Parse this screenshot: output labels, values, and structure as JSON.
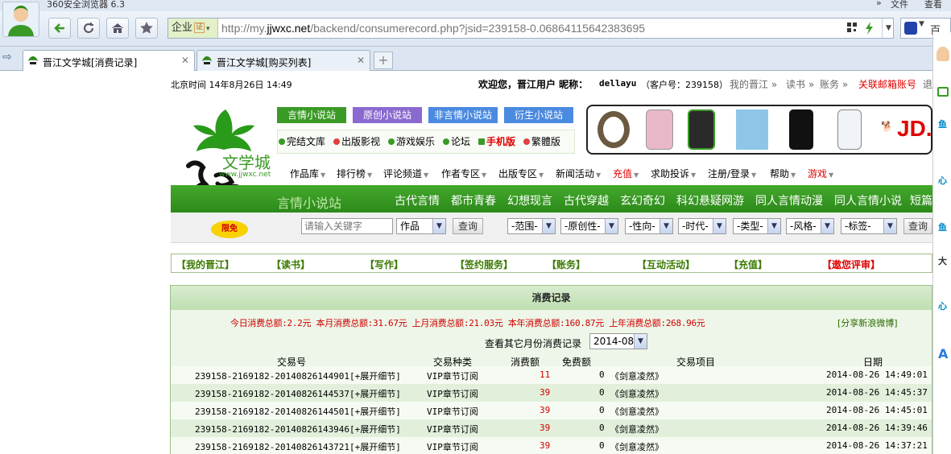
{
  "browser": {
    "title": "360安全浏览器 6.3",
    "menu": [
      "文件",
      "查看"
    ],
    "address_prefix": "企业",
    "address_badge": "证",
    "url_domain_pre": "http://my.",
    "url_domain": "jjwxc.net",
    "url_path": "/backend/consumerecord.php?jsid=239158-0.06864115642383695",
    "tabs": [
      {
        "label": "晋江文学城[消费记录]",
        "active": true
      },
      {
        "label": "晋江文学城[购买列表]",
        "active": false
      }
    ],
    "new_tab": "+",
    "sidebar_snippets": [
      "鱼",
      "心",
      "鱼",
      "大",
      "心",
      "A"
    ]
  },
  "header": {
    "time_label": "北京时间 14年8月26日 14:49",
    "welcome": "欢迎您，晋江用户 昵称：",
    "nickname": "dellayu",
    "customer_no": "（客户号：239158）",
    "links": [
      "我的晋江 »",
      "读书 »",
      "账务 »"
    ],
    "mail_link": "关联邮箱账号",
    "extra": "退"
  },
  "logo": {
    "site_name": "文学城",
    "site_url": "www.jjwxc.net",
    "brand": "晋江"
  },
  "site_buttons": [
    {
      "label": "言情小说站",
      "color": "#3a9a26"
    },
    {
      "label": "原创小说站",
      "color": "#8a6ad0"
    },
    {
      "label": "非言情小说站",
      "color": "#4a8ae0"
    },
    {
      "label": "衍生小说站",
      "color": "#4a8ae0"
    }
  ],
  "sub_links": [
    {
      "label": "完结文库",
      "color": "#3a9a26",
      "text_color": "#000"
    },
    {
      "label": "出版影视",
      "color": "#e04040",
      "text_color": "#000"
    },
    {
      "label": "游戏娱乐",
      "color": "#3a9a26",
      "text_color": "#000"
    },
    {
      "label": "论坛",
      "color": "#3a9a26",
      "text_color": "#000"
    },
    {
      "label": "手机版",
      "color": "#3a9a26",
      "text_color": "#e00000"
    },
    {
      "label": "繁體版",
      "color": "#e04040",
      "text_color": "#000"
    }
  ],
  "ad": {
    "brand": "JD."
  },
  "main_menu": [
    {
      "label": "作品库",
      "color": "#000"
    },
    {
      "label": "排行榜",
      "color": "#000"
    },
    {
      "label": "评论频道",
      "color": "#000"
    },
    {
      "label": "作者专区",
      "color": "#000"
    },
    {
      "label": "出版专区",
      "color": "#000"
    },
    {
      "label": "新闻活动",
      "color": "#000"
    },
    {
      "label": "充值",
      "color": "#e00000"
    },
    {
      "label": "求助投诉",
      "color": "#000"
    },
    {
      "label": "注册/登录",
      "color": "#000"
    },
    {
      "label": "帮助",
      "color": "#000"
    },
    {
      "label": "游戏",
      "color": "#e00000"
    }
  ],
  "channel_bar": {
    "site": "言情小说站",
    "items": [
      "古代言情",
      "都市青春",
      "幻想现言",
      "古代穿越",
      "玄幻奇幻",
      "科幻悬疑网游",
      "同人言情动漫",
      "同人言情小说",
      "短篇"
    ]
  },
  "search": {
    "badge": "限免",
    "placeholder": "请输入关键字",
    "type": "作品",
    "button": "查询",
    "filters": [
      "-范围-",
      "-原创性-",
      "-性向-",
      "-时代-",
      "-类型-",
      "-风格-",
      "-标签-"
    ],
    "button2": "查询"
  },
  "account_links": [
    {
      "label": "【我的晋江】",
      "color": "#3a7a00"
    },
    {
      "label": "【读书】",
      "color": "#3a7a00"
    },
    {
      "label": "【写作】",
      "color": "#3a7a00"
    },
    {
      "label": "【签约服务】",
      "color": "#3a7a00"
    },
    {
      "label": "【账务】",
      "color": "#3a7a00"
    },
    {
      "label": "【互动活动】",
      "color": "#3a7a00"
    },
    {
      "label": "【充值】",
      "color": "#3a7a00"
    },
    {
      "label": "【遨您评审】",
      "color": "#e00000"
    }
  ],
  "record": {
    "title": "消费记录",
    "summary": "今日消费总额:2.2元 本月消费总额:31.67元 上月消费总额:21.03元 本年消费总额:160.87元 上年消费总额:268.96元",
    "share": "[分享新浪微博]",
    "month_label": "查看其它月份消费记录",
    "month_value": "2014-08",
    "columns": [
      "交易号",
      "交易种类",
      "消费额",
      "免费额",
      "交易项目",
      "日期"
    ],
    "rows": [
      [
        "239158-2169182-20140826144901[+展开细节]",
        "VIP章节订阅",
        "11",
        "0",
        "《剑意凌然》",
        "2014-08-26 14:49:01"
      ],
      [
        "239158-2169182-20140826144537[+展开细节]",
        "VIP章节订阅",
        "39",
        "0",
        "《剑意凌然》",
        "2014-08-26 14:45:37"
      ],
      [
        "239158-2169182-20140826144501[+展开细节]",
        "VIP章节订阅",
        "39",
        "0",
        "《剑意凌然》",
        "2014-08-26 14:45:01"
      ],
      [
        "239158-2169182-20140826143946[+展开细节]",
        "VIP章节订阅",
        "39",
        "0",
        "《剑意凌然》",
        "2014-08-26 14:39:46"
      ],
      [
        "239158-2169182-20140826143721[+展开细节]",
        "VIP章节订阅",
        "39",
        "0",
        "《剑意凌然》",
        "2014-08-26 14:37:21"
      ]
    ]
  }
}
